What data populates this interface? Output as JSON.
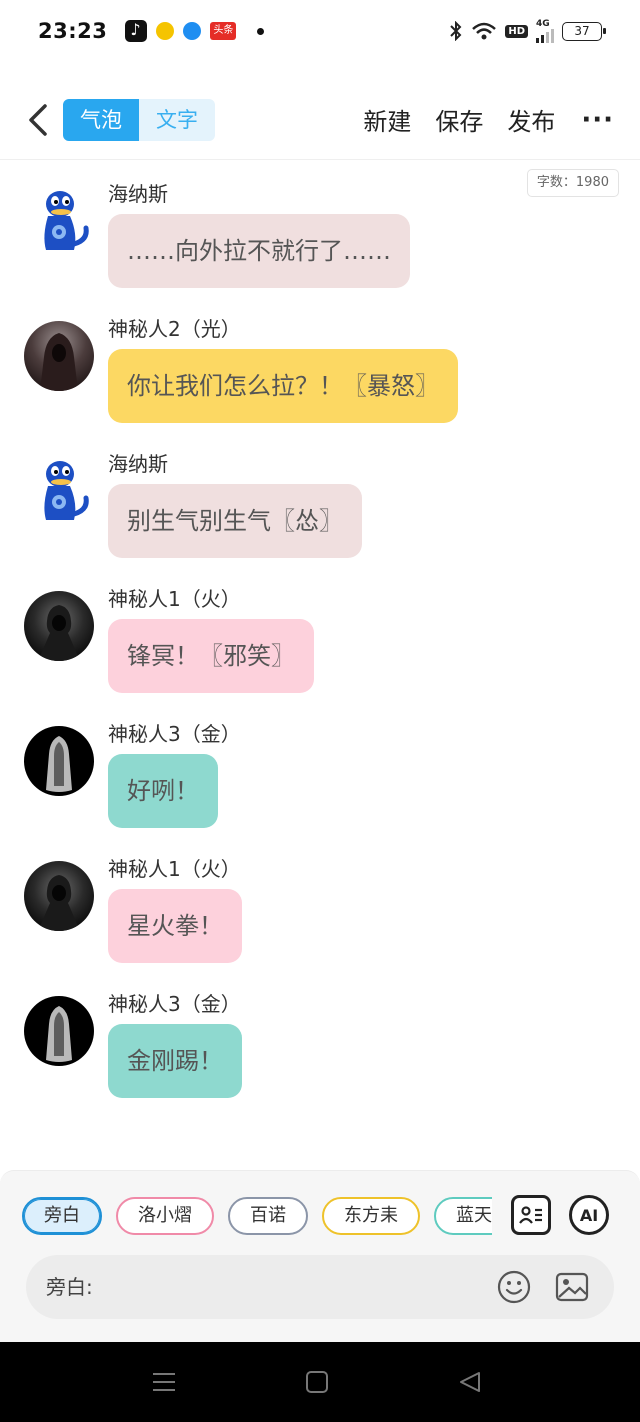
{
  "status_bar": {
    "time": "23:23",
    "toutiao": "头条",
    "hd": "HD",
    "network": "4G",
    "battery": "37"
  },
  "nav": {
    "tabs": [
      "气泡",
      "文字"
    ],
    "actions": [
      "新建",
      "保存",
      "发布"
    ],
    "more": "···"
  },
  "word_count": "字数：1980",
  "messages": [
    {
      "sender": "海纳斯",
      "text": "……向外拉不就行了……",
      "avatar": "mascot-avatar",
      "color": "#f0dfdf"
    },
    {
      "sender": "神秘人2（光）",
      "text": "你让我们怎么拉？！〖暴怒〗",
      "avatar": "hooded-figure-avatar",
      "color": "#fcd863"
    },
    {
      "sender": "海纳斯",
      "text": "别生气别生气〖怂〗",
      "avatar": "mascot-avatar",
      "color": "#f0dfdf"
    },
    {
      "sender": "神秘人1（火）",
      "text": "锋冥！〖邪笑〗",
      "avatar": "dark-hoodie-avatar",
      "color": "#fdd1dc"
    },
    {
      "sender": "神秘人3（金）",
      "text": "好咧！",
      "avatar": "cloaked-figure-avatar",
      "color": "#8ed9cf"
    },
    {
      "sender": "神秘人1（火）",
      "text": "星火拳！",
      "avatar": "dark-hoodie-avatar",
      "color": "#fdd1dc"
    },
    {
      "sender": "神秘人3（金）",
      "text": "金刚踢！",
      "avatar": "cloaked-figure-avatar",
      "color": "#8ed9cf"
    }
  ],
  "composer": {
    "chips": [
      "旁白",
      "洛小熠",
      "百诺",
      "东方耒",
      "蓝天画"
    ],
    "ai_label": "AI",
    "input_label": "旁白:"
  }
}
